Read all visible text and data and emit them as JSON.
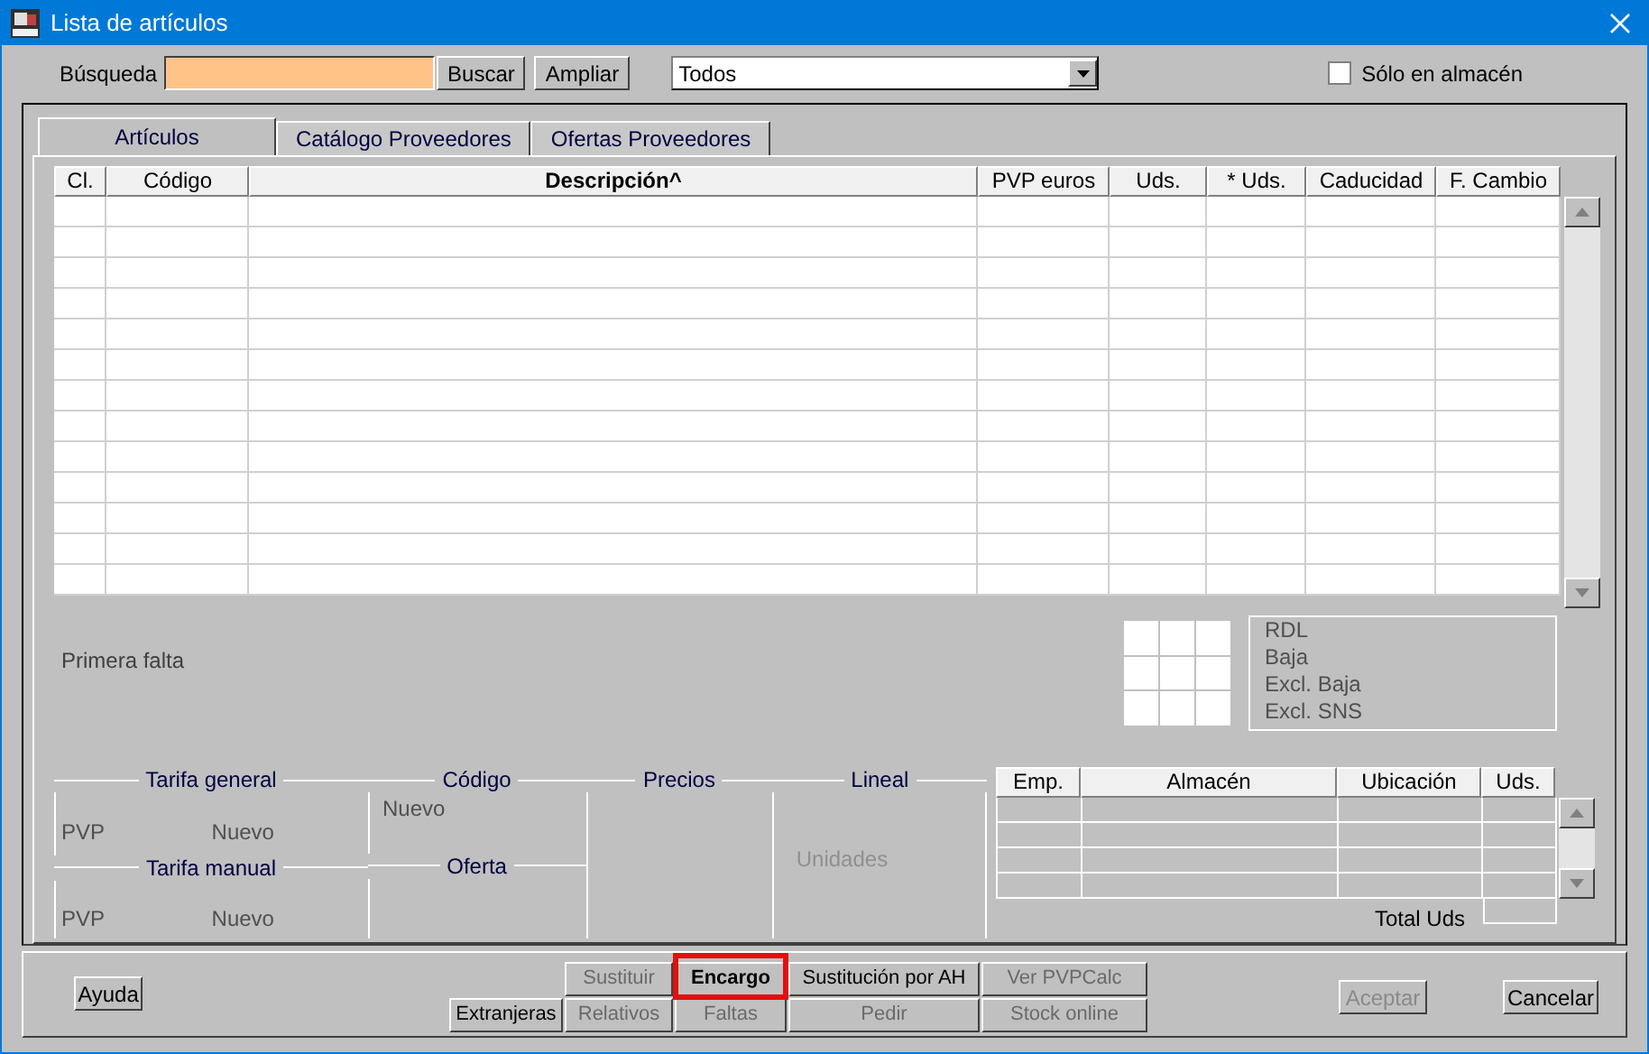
{
  "window": {
    "title": "Lista de artículos"
  },
  "search": {
    "label": "Búsqueda",
    "buttons": [
      {
        "label": "Buscar"
      },
      {
        "label": "Ampliar"
      }
    ],
    "filter": {
      "value": "Todos"
    },
    "stock_only": {
      "label": "Sólo en almacén",
      "checked": false
    }
  },
  "tabs": [
    {
      "label": "Artículos",
      "selected": true
    },
    {
      "label": "Catálogo Proveedores",
      "selected": false
    },
    {
      "label": "Ofertas Proveedores",
      "selected": false
    }
  ],
  "table": {
    "columns": [
      {
        "label": "Cl.",
        "sorted": false
      },
      {
        "label": "Código",
        "sorted": false
      },
      {
        "label": "Descripción^",
        "sorted": true
      },
      {
        "label": "PVP euros",
        "sorted": false
      },
      {
        "label": "Uds.",
        "sorted": false
      },
      {
        "label": "* Uds.",
        "sorted": false
      },
      {
        "label": "Caducidad",
        "sorted": false
      },
      {
        "label": "F. Cambio",
        "sorted": false
      }
    ]
  },
  "first_missing": {
    "label": "Primera falta"
  },
  "flags": [
    "RDL",
    "Baja",
    "Excl. Baja",
    "Excl. SNS"
  ],
  "groups": {
    "tarifa_general": {
      "title": "Tarifa general",
      "label": "PVP",
      "value": "Nuevo"
    },
    "tarifa_manual": {
      "title": "Tarifa manual",
      "label": "PVP",
      "value": "Nuevo"
    },
    "codigo": {
      "title": "Código",
      "value": "Nuevo"
    },
    "oferta": {
      "title": "Oferta"
    },
    "precios": {
      "title": "Precios"
    },
    "lineal": {
      "title": "Lineal",
      "value": "Unidades"
    }
  },
  "stock_table": {
    "columns": [
      "Emp.",
      "Almacén",
      "Ubicación",
      "Uds."
    ],
    "total_label": "Total Uds"
  },
  "footer": {
    "help": {
      "label": "Ayuda",
      "disabled": false
    },
    "actions_row_1": [
      {
        "label": "Sustituir",
        "disabled": true,
        "highlighted": false
      },
      {
        "label": "Encargo",
        "disabled": false,
        "highlighted": true
      },
      {
        "label": "Sustitución por AH",
        "disabled": false,
        "highlighted": false
      },
      {
        "label": "Ver PVPCalc",
        "disabled": true,
        "highlighted": false
      }
    ],
    "actions_row_2": [
      {
        "label": "Extranjeras",
        "disabled": false,
        "highlighted": false
      },
      {
        "label": "Relativos",
        "disabled": true,
        "highlighted": false
      },
      {
        "label": "Faltas",
        "disabled": true,
        "highlighted": false
      },
      {
        "label": "Pedir",
        "disabled": true,
        "highlighted": false
      },
      {
        "label": "Stock online",
        "disabled": true,
        "highlighted": false
      }
    ],
    "accept": {
      "label": "Aceptar",
      "disabled": true
    },
    "cancel": {
      "label": "Cancelar",
      "disabled": false
    }
  }
}
